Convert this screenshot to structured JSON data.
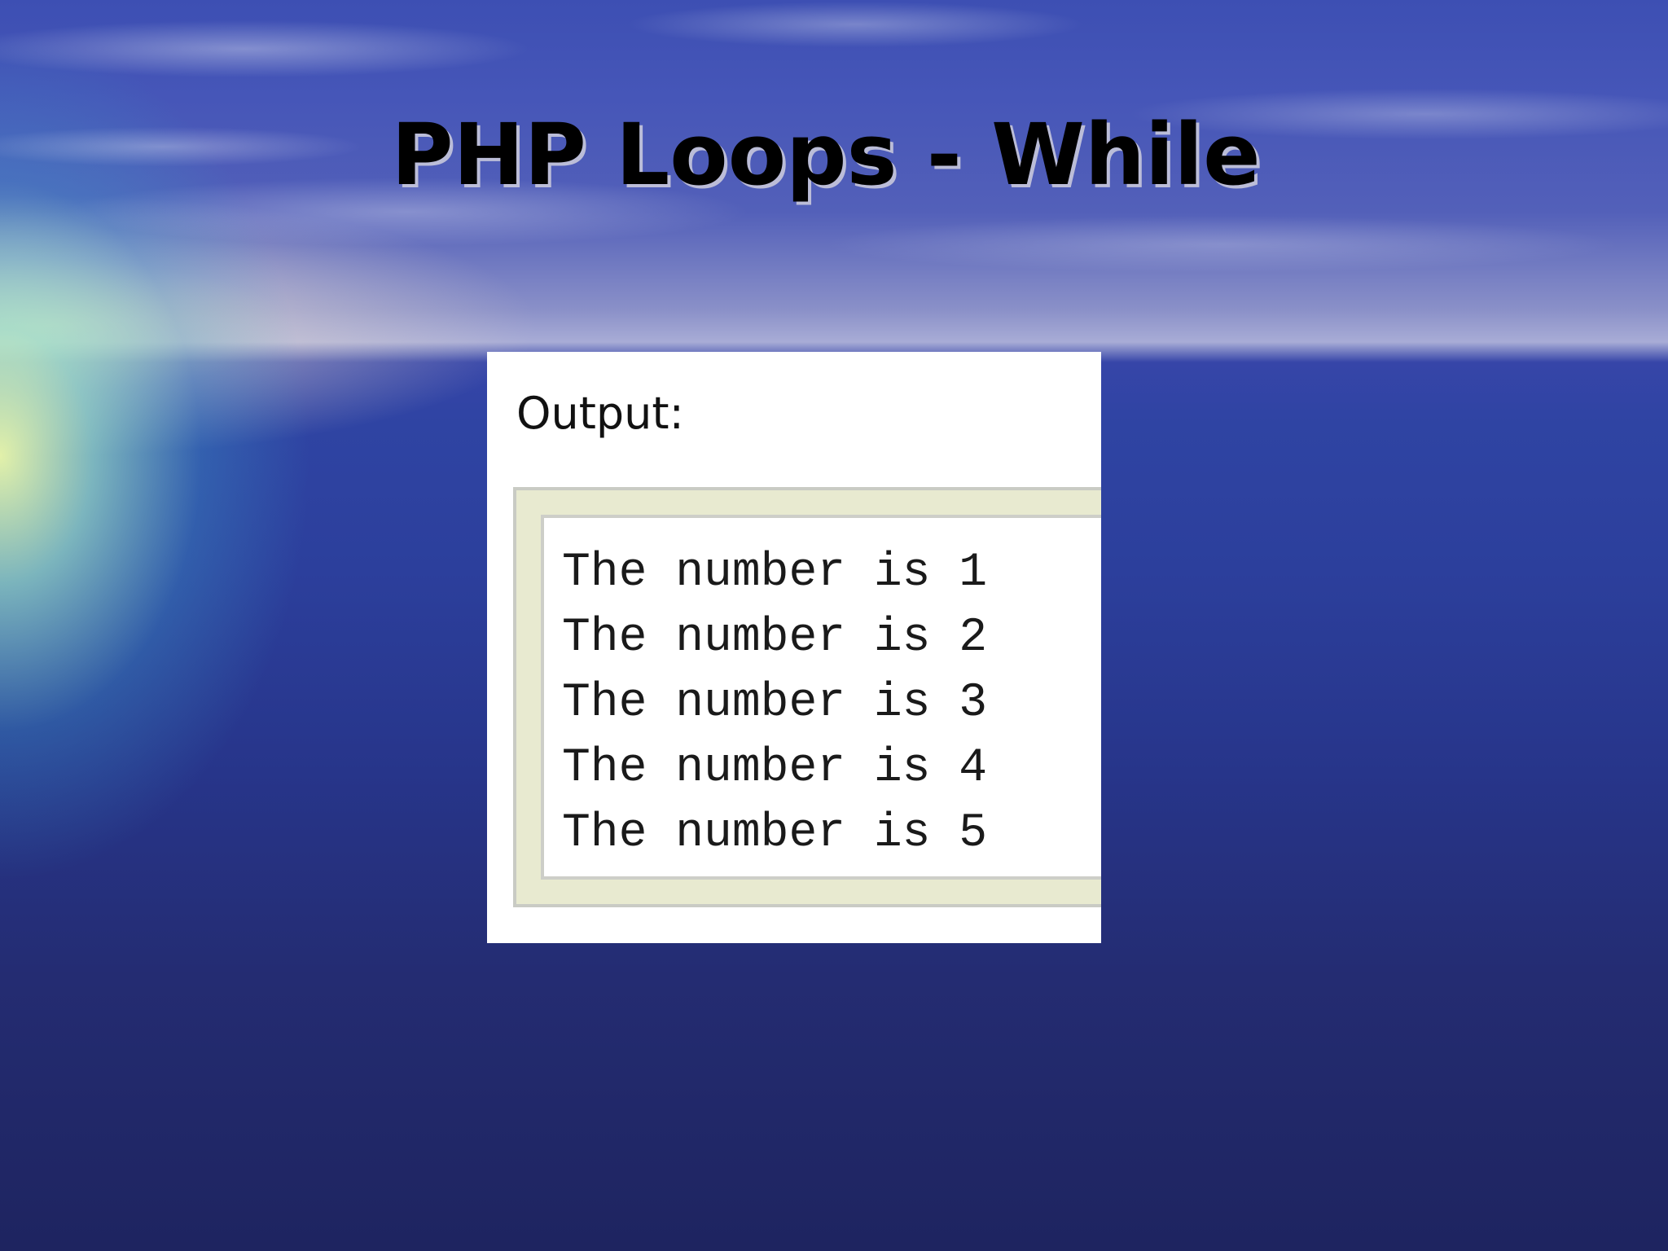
{
  "slide": {
    "title": "PHP Loops - While",
    "output": {
      "label": "Output:",
      "lines": [
        "The number is 1",
        "The number is 2",
        "The number is 3",
        "The number is 4",
        "The number is 5"
      ]
    }
  }
}
